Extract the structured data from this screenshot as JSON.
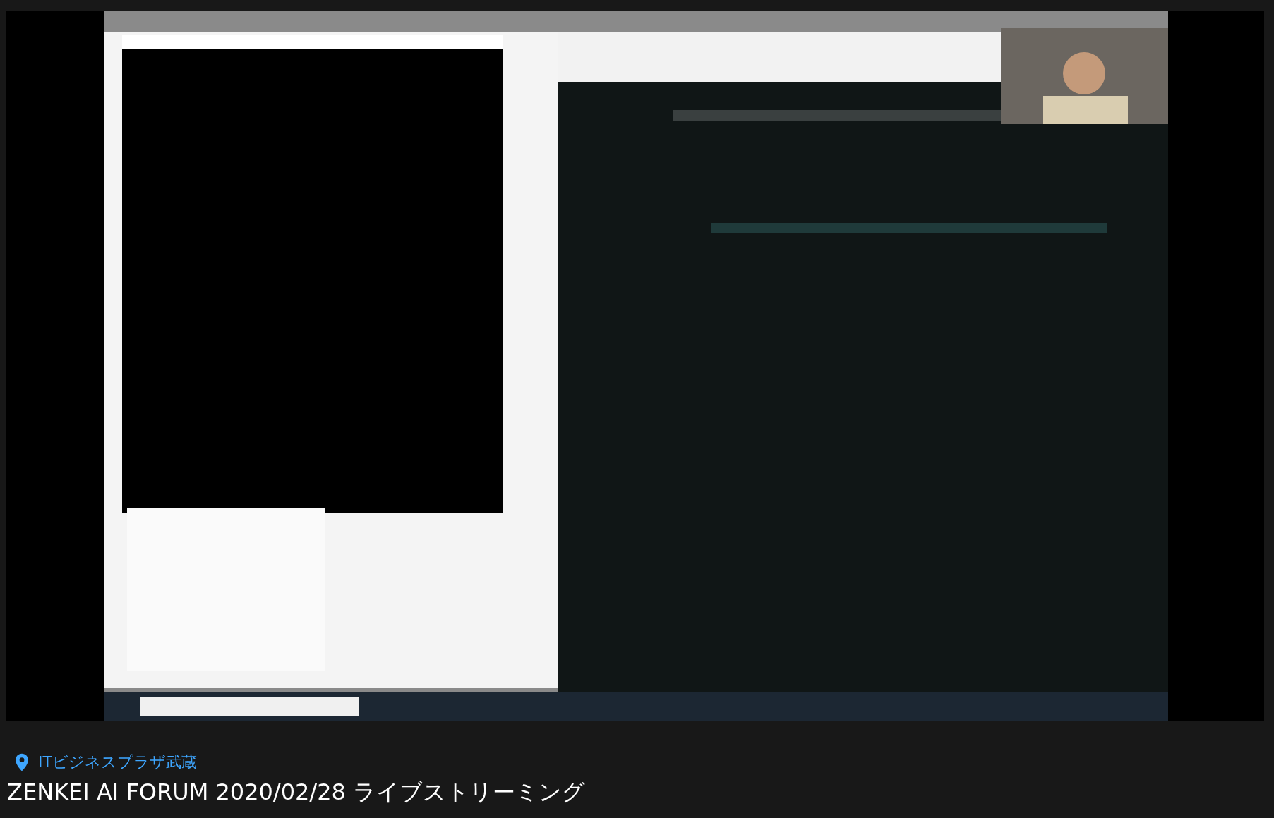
{
  "location": "ITビジネスプラザ武蔵",
  "title": "ZENKEI AI FORUM 2020/02/28 ライブストリーミング"
}
